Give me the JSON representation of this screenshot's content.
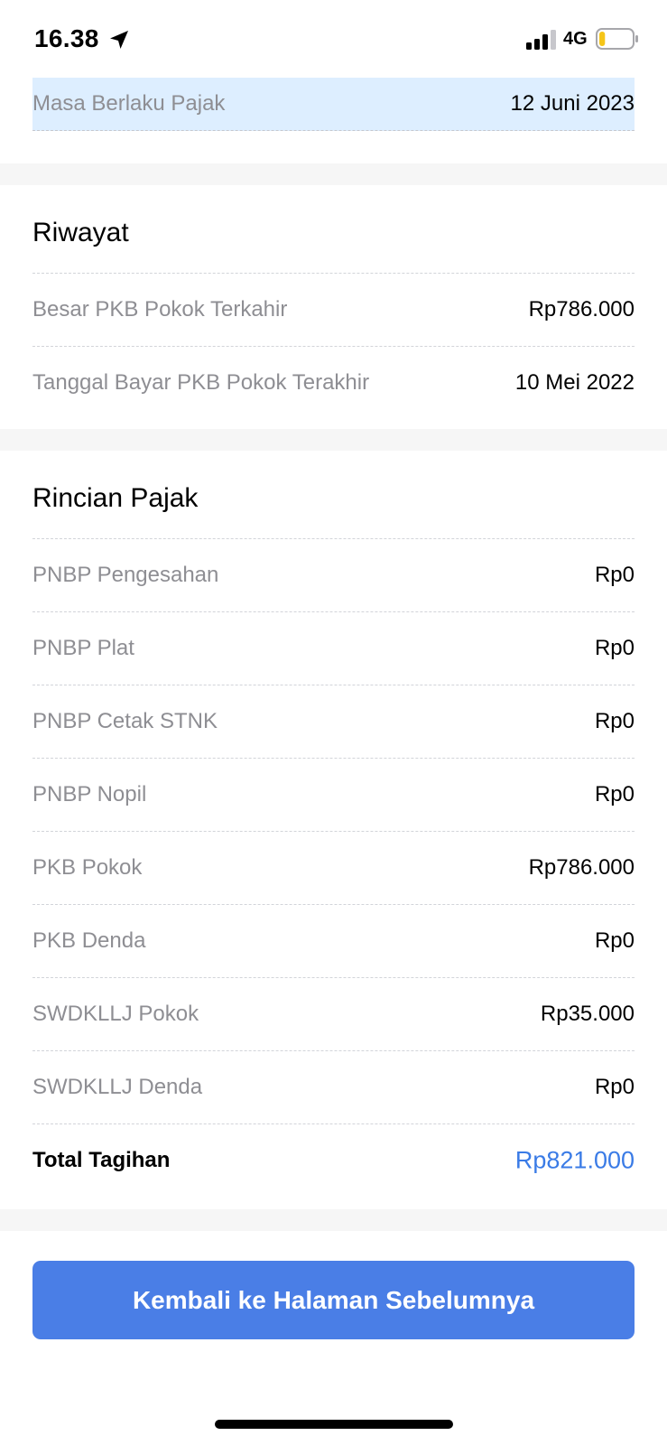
{
  "status_bar": {
    "time": "16.38",
    "network": "4G",
    "icons": [
      "location-arrow-icon",
      "signal-bars-icon",
      "battery-low-icon"
    ],
    "battery_level": 0.18,
    "battery_color": "#f5c518"
  },
  "validity": {
    "label": "Masa Berlaku Pajak",
    "value": "12 Juni 2023",
    "highlight_color": "#ddeeff"
  },
  "history": {
    "title": "Riwayat",
    "rows": [
      {
        "label": "Besar PKB Pokok Terkahir",
        "value": "Rp786.000"
      },
      {
        "label": "Tanggal Bayar PKB Pokok Terakhir",
        "value": "10 Mei 2022"
      }
    ]
  },
  "tax_details": {
    "title": "Rincian Pajak",
    "rows": [
      {
        "label": "PNBP Pengesahan",
        "value": "Rp0"
      },
      {
        "label": "PNBP Plat",
        "value": "Rp0"
      },
      {
        "label": "PNBP Cetak STNK",
        "value": "Rp0"
      },
      {
        "label": "PNBP Nopil",
        "value": "Rp0"
      },
      {
        "label": "PKB Pokok",
        "value": "Rp786.000"
      },
      {
        "label": "PKB Denda",
        "value": "Rp0"
      },
      {
        "label": "SWDKLLJ Pokok",
        "value": "Rp35.000"
      },
      {
        "label": "SWDKLLJ Denda",
        "value": "Rp0"
      }
    ],
    "total": {
      "label": "Total Tagihan",
      "value": "Rp821.000",
      "color": "#3a7be6"
    }
  },
  "actions": {
    "back_label": "Kembali ke Halaman Sebelumnya",
    "button_color": "#4a7ee6"
  }
}
